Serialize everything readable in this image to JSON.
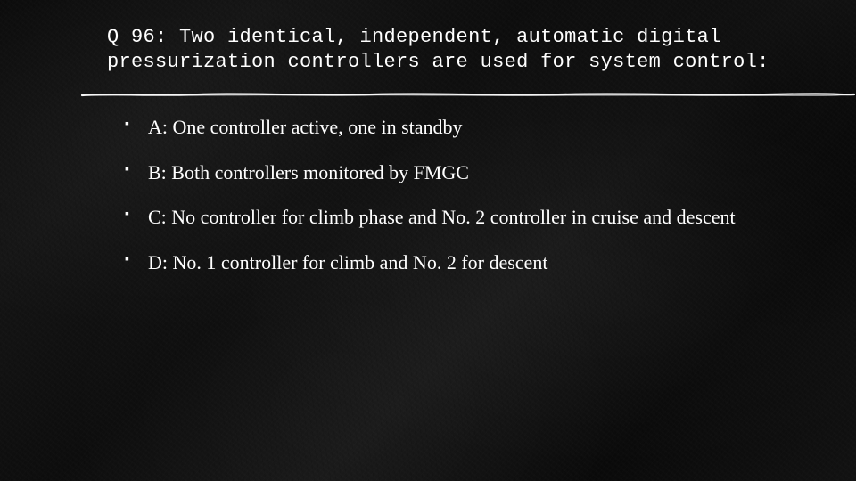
{
  "slide": {
    "question": "Q 96: Two identical, independent, automatic digital pressurization controllers are used for system control:",
    "options": [
      "A: One controller active, one in standby",
      "B: Both controllers monitored by FMGC",
      "C: No controller for climb phase and No. 2 controller in cruise and descent",
      "D: No. 1 controller for climb and No. 2 for descent"
    ]
  }
}
